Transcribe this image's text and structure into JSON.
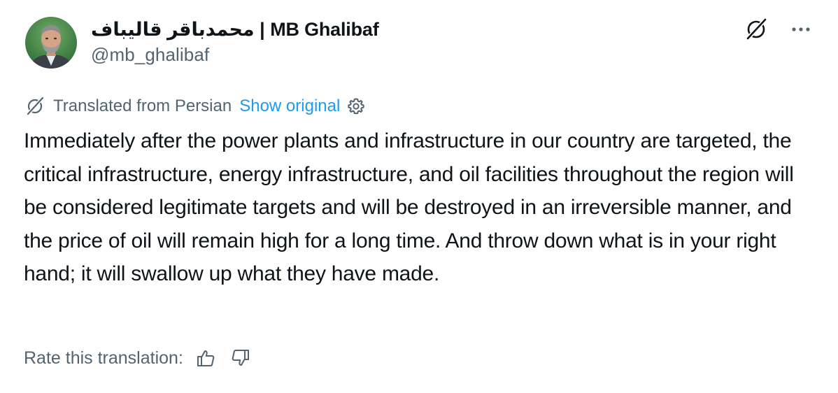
{
  "author": {
    "display_name": "محمدباقر قالیباف | MB Ghalibaf",
    "handle": "@mb_ghalibaf"
  },
  "icons": {
    "grok": "grok-slash-circle-icon",
    "more": "more-horizontal-icon",
    "translate": "grok-slash-circle-icon",
    "settings": "gear-icon",
    "thumb_up": "thumb-up-icon",
    "thumb_down": "thumb-down-icon"
  },
  "translation": {
    "label": "Translated from Persian",
    "show_original": "Show original"
  },
  "tweet": {
    "text": "Immediately after the power plants and infrastructure in our country are targeted, the critical infrastructure, energy infrastructure, and oil facilities throughout the region will be considered legitimate targets and will be destroyed in an irreversible manner, and the price of oil will remain high for a long time. And throw down what is in your right hand; it will swallow up what they have made."
  },
  "rating": {
    "label": "Rate this translation:"
  },
  "colors": {
    "text": "#0f1419",
    "secondary": "#536471",
    "link": "#1d9bf0",
    "background": "#ffffff"
  }
}
